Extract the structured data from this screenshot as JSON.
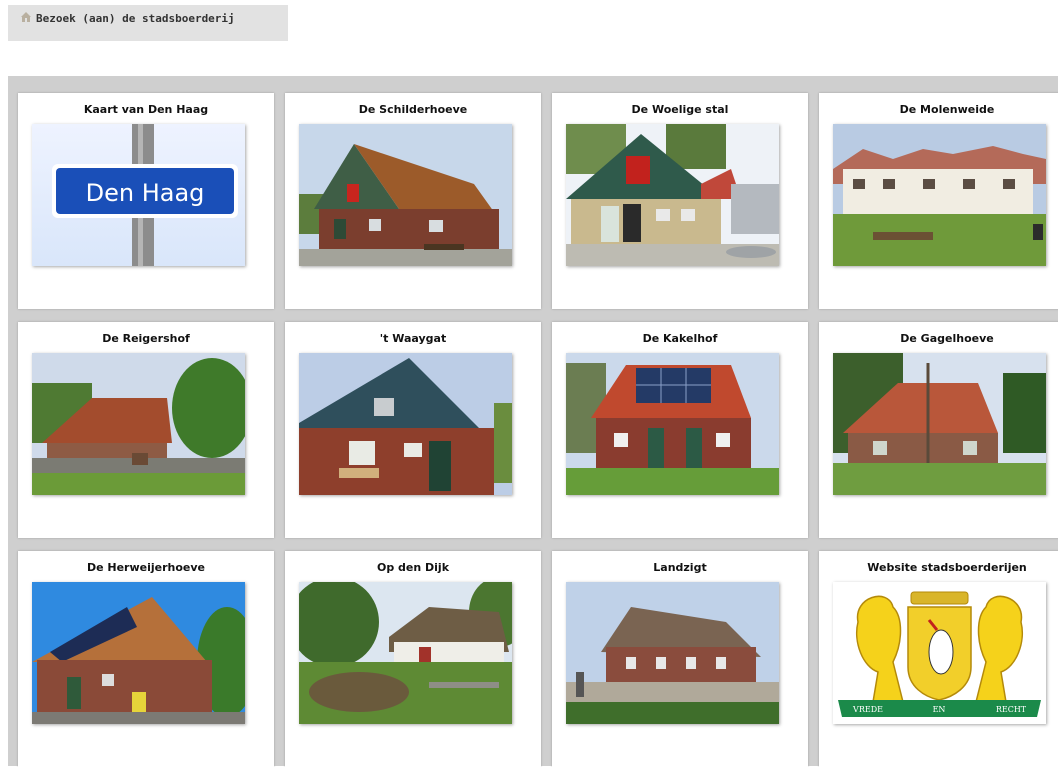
{
  "header": {
    "title": "Bezoek (aan) de stadsboerderij",
    "icon": "farm-icon"
  },
  "tiles": [
    {
      "title": "Kaart van Den Haag",
      "image": "den-haag-sign-photo",
      "sign_text": "Den Haag"
    },
    {
      "title": "De Schilderhoeve",
      "image": "farmhouse-photo"
    },
    {
      "title": "De Woelige stal",
      "image": "farmhouse-photo"
    },
    {
      "title": "De Molenweide",
      "image": "farm-meadow-photo"
    },
    {
      "title": "De Reigershof",
      "image": "farmhouse-photo"
    },
    {
      "title": "'t Waaygat",
      "image": "farmhouse-photo"
    },
    {
      "title": "De Kakelhof",
      "image": "farmhouse-solar-photo"
    },
    {
      "title": "De Gagelhoeve",
      "image": "farmhouse-photo"
    },
    {
      "title": "De Herweijerhoeve",
      "image": "farmhouse-solar-photo"
    },
    {
      "title": "Op den Dijk",
      "image": "thatched-farm-photo"
    },
    {
      "title": "Landzigt",
      "image": "farmhouse-photo"
    },
    {
      "title": "Website stadsboerderijen",
      "image": "den-haag-coat-of-arms",
      "motto": [
        "VREDE",
        "EN",
        "RECHT"
      ]
    }
  ]
}
